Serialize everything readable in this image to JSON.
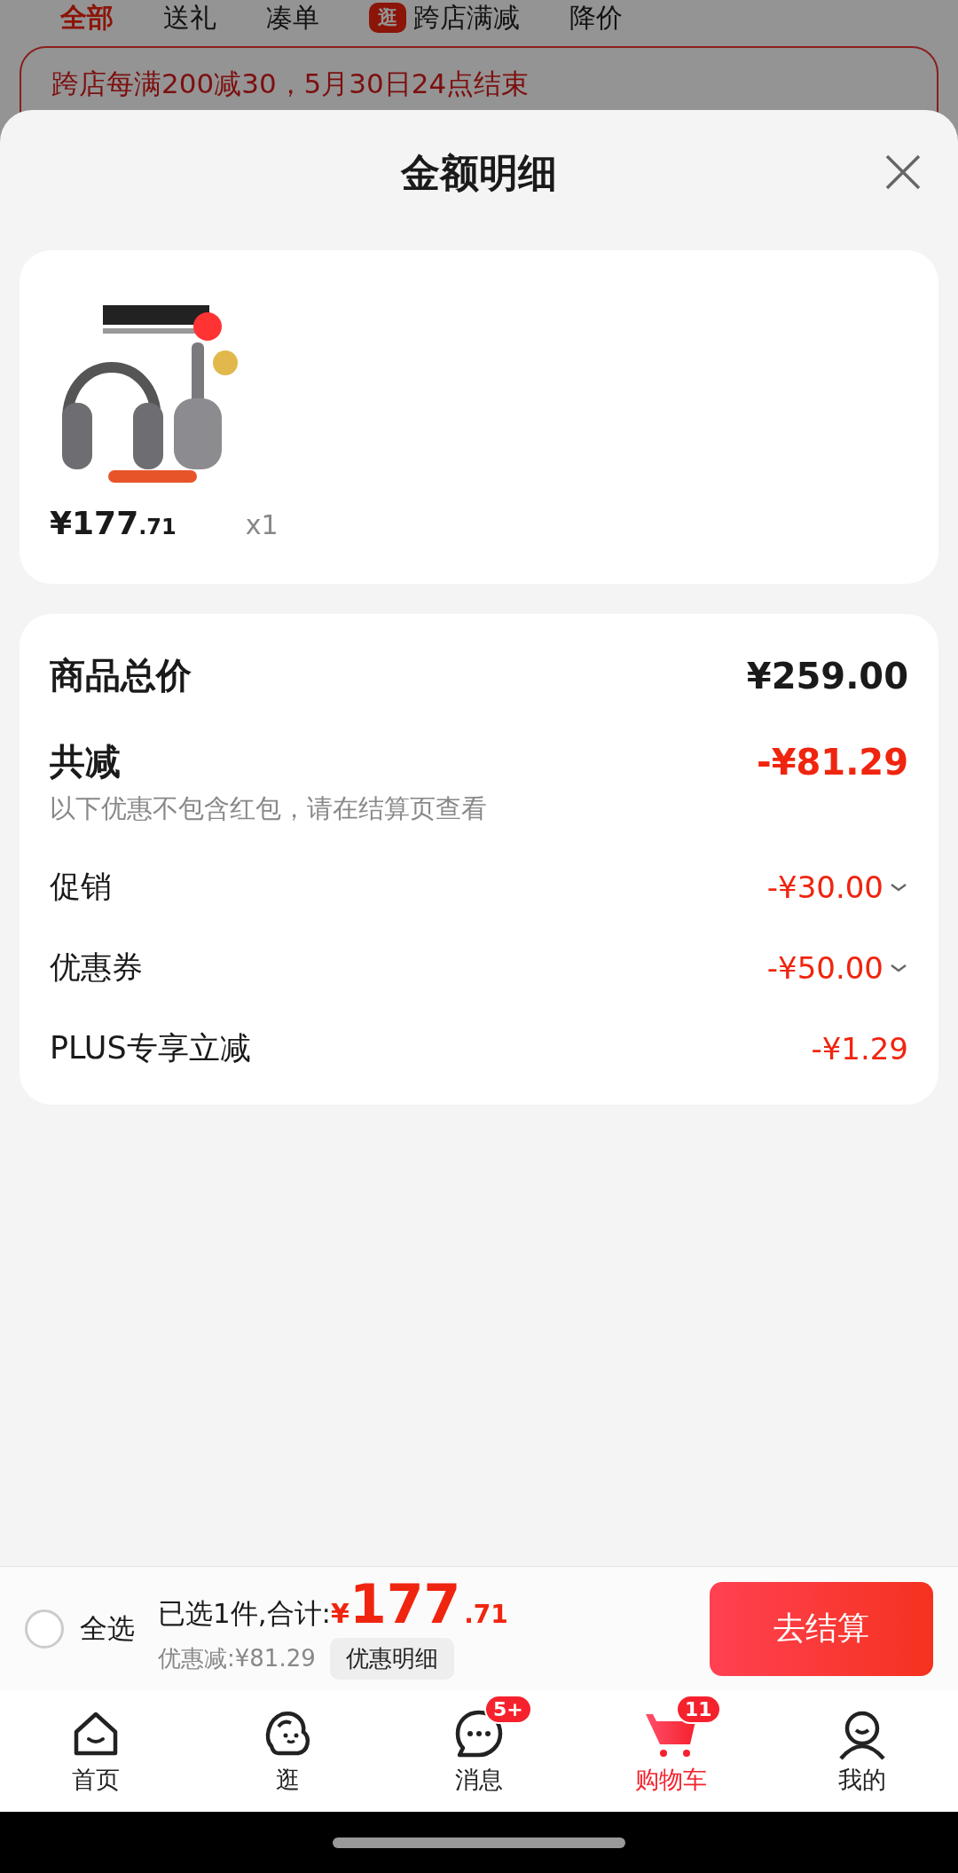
{
  "background": {
    "tabs": [
      {
        "label": "全部",
        "selected": true
      },
      {
        "label": "送礼",
        "selected": false
      },
      {
        "label": "凑单",
        "selected": false
      },
      {
        "label": "跨店满减",
        "selected": false,
        "badge": "逛"
      },
      {
        "label": "降价",
        "selected": false
      }
    ],
    "banner": {
      "text": "跨店每满200减30，5月30日24点结束"
    }
  },
  "sheet": {
    "title": "金额明细",
    "product": {
      "price_main": "¥177",
      "price_decimal": ".71",
      "quantity": "x1"
    },
    "summary": {
      "total_label": "商品总价",
      "total_value": "¥259.00",
      "discount_label": "共减",
      "discount_value": "-¥81.29",
      "discount_note": "以下优惠不包含红包，请在结算页查看",
      "rows": [
        {
          "label": "促销",
          "value": "-¥30.00",
          "expandable": true
        },
        {
          "label": "优惠券",
          "value": "-¥50.00",
          "expandable": true
        },
        {
          "label": "PLUS专享立减",
          "value": "-¥1.29",
          "expandable": false
        }
      ]
    }
  },
  "cart_bar": {
    "select_all": {
      "label": "全选",
      "checked": false
    },
    "summary_label": "已选1件,合计:",
    "currency": "¥",
    "amount": "177",
    "decimal": ".71",
    "saved": "优惠减:¥81.29",
    "details_button": "优惠明细",
    "checkout_button": "去结算"
  },
  "nav": [
    {
      "kind": "home",
      "label": "首页",
      "selected": false
    },
    {
      "kind": "explore",
      "label": "逛",
      "selected": false
    },
    {
      "kind": "message",
      "label": "消息",
      "selected": false,
      "badge": "5+"
    },
    {
      "kind": "cart",
      "label": "购物车",
      "selected": true,
      "badge": "11"
    },
    {
      "kind": "profile",
      "label": "我的",
      "selected": false
    }
  ]
}
